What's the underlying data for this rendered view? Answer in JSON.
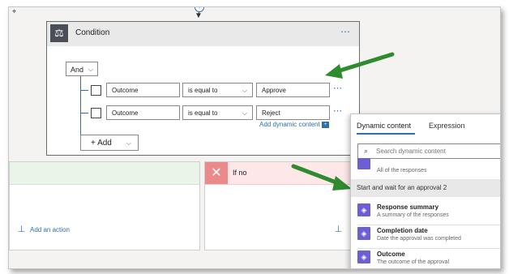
{
  "condition": {
    "title": "Condition",
    "more": "⋯",
    "group_operator": "And",
    "rows": [
      {
        "left": "Outcome",
        "operator": "is equal to",
        "right": "Approve"
      },
      {
        "left": "Outcome",
        "operator": "is equal to",
        "right": "Reject"
      }
    ],
    "add_dynamic_content": "Add dynamic content",
    "add_label": "Add"
  },
  "branches": {
    "no_title": "If no",
    "add_action": "Add an action"
  },
  "dynamic_panel": {
    "tab_dynamic": "Dynamic content",
    "tab_expression": "Expression",
    "search_placeholder": "Search dynamic content",
    "cut_item_desc": "All of the responses",
    "section_title": "Start and wait for an approval 2",
    "items": [
      {
        "name": "Response summary",
        "desc": "A summary of the responses"
      },
      {
        "name": "Completion date",
        "desc": "Date the approval was completed"
      },
      {
        "name": "Outcome",
        "desc": "The outcome of the approval"
      }
    ]
  },
  "colors": {
    "accent": "#2f6fb0",
    "arrow": "#2e8b2e",
    "dynamic_icon": "#6b5fd3",
    "no_branch": "#fde7e9",
    "yes_branch": "#e8f5e8"
  },
  "icons": {
    "condition": "condition-icon",
    "dynamic_item": "approval-icon",
    "search": "search-icon",
    "close": "close-icon",
    "add_action": "add-action-icon"
  }
}
